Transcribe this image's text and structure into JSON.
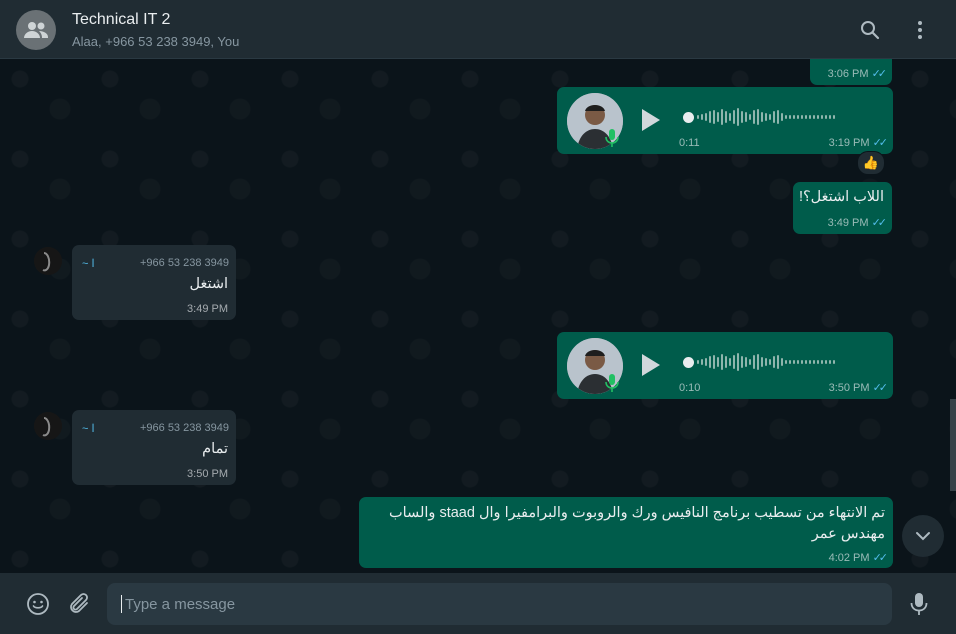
{
  "header": {
    "title": "Technical IT 2",
    "members": "Alaa, +966 53 238 3949, You",
    "icons": [
      "group-avatar-icon",
      "search-icon",
      "menu-icon"
    ]
  },
  "messages": [
    {
      "type": "outgoing-partial",
      "time": "3:06 PM",
      "status": "read"
    },
    {
      "type": "outgoing-voice",
      "duration": "0:11",
      "time": "3:19 PM",
      "status": "read",
      "reaction": "👍"
    },
    {
      "type": "outgoing-text",
      "text": "اللاب اشتغل؟!",
      "time": "3:49 PM",
      "status": "read"
    },
    {
      "type": "incoming-text",
      "sender_phone": "+966 53 238 3949",
      "sender_name": "~ ا",
      "text": "اشتغل",
      "time": "3:49 PM"
    },
    {
      "type": "outgoing-voice",
      "duration": "0:10",
      "time": "3:50 PM",
      "status": "read"
    },
    {
      "type": "incoming-text",
      "sender_phone": "+966 53 238 3949",
      "sender_name": "~ ا",
      "text": "تمام",
      "time": "3:50 PM"
    },
    {
      "type": "outgoing-text",
      "text": "تم الانتهاء من تسطيب برنامج النافيس ورك والروبوت والبرامفيرا وال staad والساب مهندس عمر",
      "time": "4:02 PM",
      "status": "read"
    }
  ],
  "composer": {
    "placeholder": "Type a message",
    "icons": [
      "emoji-icon",
      "attach-icon",
      "mic-icon"
    ]
  },
  "colors": {
    "outgoing": "#005c4b",
    "incoming": "#202c33",
    "background": "#0b141a",
    "read_ticks": "#53bdeb"
  }
}
